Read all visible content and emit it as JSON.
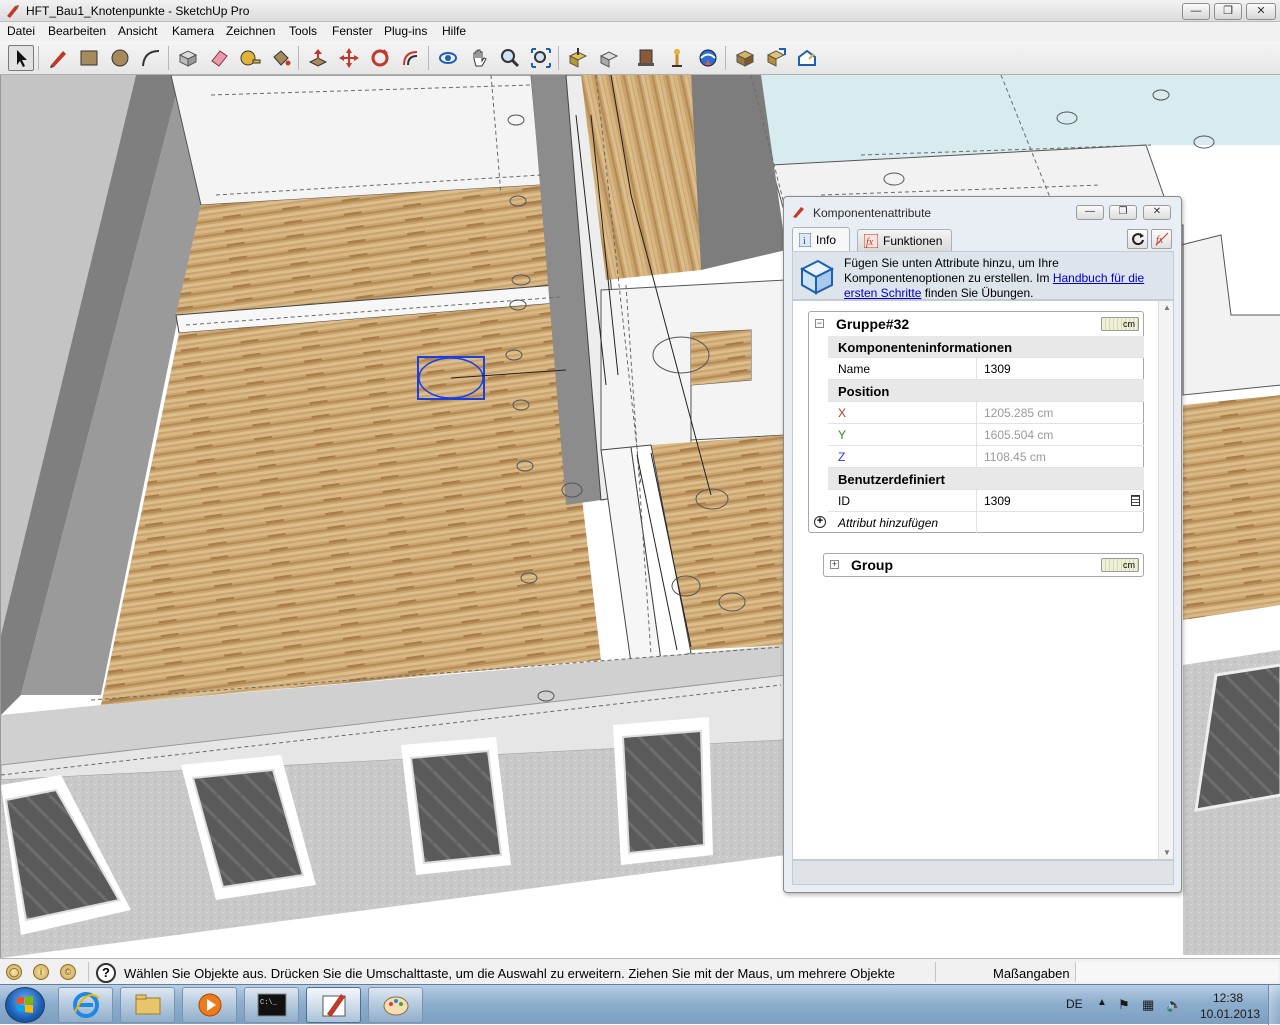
{
  "window": {
    "title": "HFT_Bau1_Knotenpunkte - SketchUp Pro",
    "minimize_icon": "minimize-icon",
    "maximize_icon": "restore-icon",
    "close_icon": "close-icon"
  },
  "menu": {
    "items": [
      "Datei",
      "Bearbeiten",
      "Ansicht",
      "Kamera",
      "Zeichnen",
      "Tools",
      "Fenster",
      "Plug-ins",
      "Hilfe"
    ]
  },
  "toolbar": {
    "tools": [
      "select-icon",
      "pencil-icon",
      "rectangle-icon",
      "circle-icon",
      "arc-icon",
      "make-component-icon",
      "eraser-icon",
      "tape-measure-icon",
      "paint-bucket-icon",
      "push-pull-icon",
      "move-icon",
      "rotate-icon",
      "offset-icon",
      "orbit-icon",
      "pan-icon",
      "zoom-icon",
      "zoom-extents-icon",
      "get-models-icon",
      "share-model-icon",
      "share-component-icon",
      "get-photo-texture-icon",
      "extension-warehouse-icon",
      "preview-google-earth-icon",
      "add-location-icon",
      "toggle-terrain-icon",
      "photo-textures-icon",
      "export-icon"
    ]
  },
  "dialog": {
    "title": "Komponentenattribute",
    "tabs": [
      {
        "label": "Info",
        "icon": "info-icon",
        "active": true
      },
      {
        "label": "Funktionen",
        "icon": "function-icon",
        "active": false
      }
    ],
    "refresh_icon": "refresh-icon",
    "toggle_formula_icon": "formula-toggle-icon",
    "hint": {
      "text_before": "Fügen Sie unten Attribute hinzu, um Ihre Komponentenoptionen zu erstellen. Im ",
      "link": "Handbuch für die ersten Schritte",
      "text_after": " finden Sie Übungen."
    },
    "component": {
      "name": "Gruppe#32",
      "unit": "cm",
      "sections": {
        "info_title": "Komponenteninformationen",
        "position_title": "Position",
        "custom_title": "Benutzerdefiniert"
      },
      "fields": {
        "name_label": "Name",
        "name_value": "1309",
        "x_label": "X",
        "x_value": "1205.285 cm",
        "y_label": "Y",
        "y_value": "1605.504 cm",
        "z_label": "Z",
        "z_value": "1108.45 cm",
        "id_label": "ID",
        "id_value": "1309"
      },
      "add_attribute": "Attribut hinzufügen"
    },
    "subgroup": {
      "name": "Group",
      "unit": "cm"
    }
  },
  "statusbar": {
    "icons": [
      "geo-location-icon",
      "credits-icon",
      "copyright-icon"
    ],
    "help_glyph": "?",
    "message": "Wählen Sie Objekte aus. Drücken Sie die Umschalttaste, um die Auswahl zu erweitern. Ziehen Sie mit der Maus, um mehrere Objekte",
    "measure_label": "Maßangaben",
    "measure_value": ""
  },
  "taskbar": {
    "apps": [
      "internet-explorer-icon",
      "file-explorer-icon",
      "media-player-icon",
      "command-prompt-icon",
      "sketchup-icon",
      "paint-icon"
    ],
    "language": "DE",
    "time": "12:38",
    "date": "10.01.2013"
  },
  "colors": {
    "accent_link": "#0000cc",
    "x_axis": "#b23b2a",
    "y_axis": "#2a8a2a",
    "z_axis": "#2a3fa8",
    "selection": "#1a3fe0"
  }
}
